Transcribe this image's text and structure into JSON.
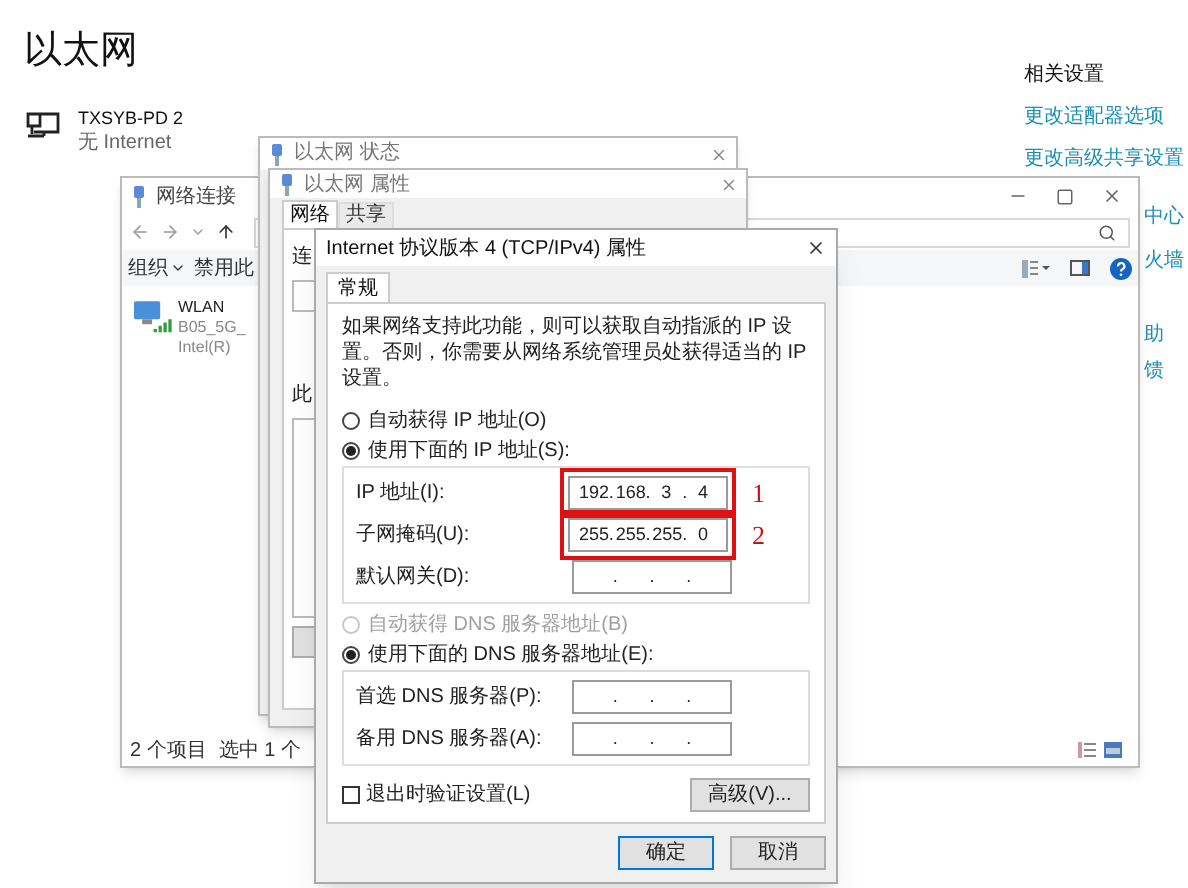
{
  "page": {
    "title": "以太网",
    "adapter": {
      "name": "TXSYB-PD 2",
      "status": "无 Internet"
    }
  },
  "related": {
    "heading": "相关设置",
    "links": [
      "更改适配器选项",
      "更改高级共享设置"
    ],
    "partial_links": [
      "中心",
      "火墙",
      "助",
      "馈"
    ]
  },
  "explorer": {
    "title": "网络连接",
    "toolbar": [
      {
        "label": "组织",
        "dropdown": true
      },
      {
        "label": "禁用此",
        "dropdown": false
      }
    ],
    "item": {
      "name": "WLAN",
      "line_2": "B05_5G_",
      "line_3": "Intel(R)"
    },
    "status_bar": [
      "2 个项目",
      "选中 1 个"
    ]
  },
  "status_window": {
    "title": "以太网 状态"
  },
  "properties": {
    "title": "以太网 属性",
    "tabs": [
      {
        "label": "网络",
        "selected": true
      },
      {
        "label": "共享",
        "selected": false
      }
    ],
    "labels": [
      "连",
      "此"
    ]
  },
  "ipv4": {
    "title": "Internet 协议版本 4 (TCP/IPv4) 属性",
    "tabs": [
      {
        "label": "常规",
        "selected": true
      }
    ],
    "description": "如果网络支持此功能，则可以获取自动指派的 IP 设置。否则，你需要从网络系统管理员处获得适当的 IP 设置。",
    "separator": ".",
    "ip_mode": [
      {
        "label": "自动获得 IP 地址(O)",
        "selected": false,
        "disabled": false
      },
      {
        "label": "使用下面的 IP 地址(S):",
        "selected": true,
        "disabled": false
      }
    ],
    "ip_fields": [
      {
        "label": "IP 地址(I):",
        "octets": [
          "192",
          "168",
          "3",
          "4"
        ],
        "highlighted": true,
        "annotation": "1"
      },
      {
        "label": "子网掩码(U):",
        "octets": [
          "255",
          "255",
          "255",
          "0"
        ],
        "highlighted": true,
        "annotation": "2"
      },
      {
        "label": "默认网关(D):",
        "highlighted": false
      }
    ],
    "dns_mode": [
      {
        "label": "自动获得 DNS 服务器地址(B)",
        "selected": false,
        "disabled": true
      },
      {
        "label": "使用下面的 DNS 服务器地址(E):",
        "selected": true,
        "disabled": false
      }
    ],
    "dns_fields": [
      {
        "label": "首选 DNS 服务器(P):",
        "highlighted": false
      },
      {
        "label": "备用 DNS 服务器(A):",
        "highlighted": false
      }
    ],
    "validate_on_exit": {
      "label": "退出时验证设置(L)",
      "checked": false
    },
    "advanced_button": "高级(V)...",
    "buttons": [
      {
        "label": "确定",
        "default": true
      },
      {
        "label": "取消",
        "default": false
      }
    ]
  }
}
